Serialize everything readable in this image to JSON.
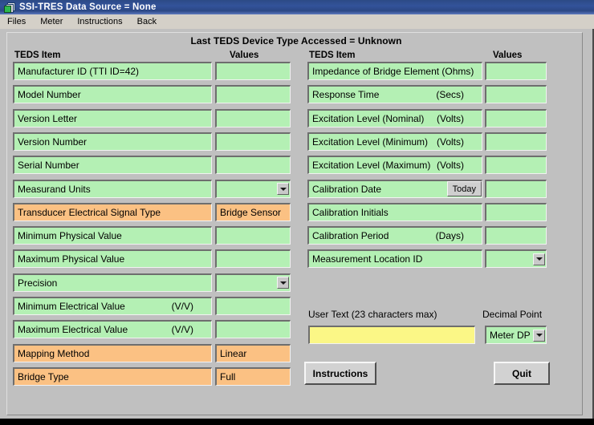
{
  "window": {
    "title": "SSI-TRES  Data Source =  None",
    "icon": "document-stack-icon"
  },
  "menubar": {
    "items": [
      {
        "label": "Files"
      },
      {
        "label": "Meter"
      },
      {
        "label": "Instructions"
      },
      {
        "label": "Back"
      }
    ]
  },
  "banner": {
    "text": "Last TEDS Device Type Accessed = Unknown"
  },
  "columns": {
    "left": {
      "item_header": "TEDS Item",
      "values_header": "Values"
    },
    "right": {
      "item_header": "TEDS Item",
      "values_header": "Values"
    }
  },
  "left_rows": [
    {
      "label": "Manufacturer ID   (TTI  ID=42)",
      "unit": "",
      "value": "",
      "color": "green",
      "control": "text"
    },
    {
      "label": "Model Number",
      "unit": "",
      "value": "",
      "color": "green",
      "control": "text"
    },
    {
      "label": "Version Letter",
      "unit": "",
      "value": "",
      "color": "green",
      "control": "text"
    },
    {
      "label": "Version Number",
      "unit": "",
      "value": "",
      "color": "green",
      "control": "text"
    },
    {
      "label": "Serial Number",
      "unit": "",
      "value": "",
      "color": "green",
      "control": "text"
    },
    {
      "label": "Measurand Units",
      "unit": "",
      "value": "",
      "color": "green",
      "control": "combo"
    },
    {
      "label": "Transducer Electrical Signal Type",
      "unit": "",
      "value": "Bridge Sensor",
      "color": "orange",
      "control": "text"
    },
    {
      "label": "Minimum Physical Value",
      "unit": "",
      "value": "",
      "color": "green",
      "control": "text"
    },
    {
      "label": "Maximum Physical Value",
      "unit": "",
      "value": "",
      "color": "green",
      "control": "text"
    },
    {
      "label": "Precision",
      "unit": "",
      "value": "",
      "color": "green",
      "control": "combo"
    },
    {
      "label": "Minimum Electrical Value",
      "unit": "(V/V)",
      "value": "",
      "color": "green",
      "control": "text"
    },
    {
      "label": "Maximum Electrical Value",
      "unit": "(V/V)",
      "value": "",
      "color": "green",
      "control": "text"
    },
    {
      "label": "Mapping Method",
      "unit": "",
      "value": "Linear",
      "color": "orange",
      "control": "text"
    },
    {
      "label": "Bridge Type",
      "unit": "",
      "value": "Full",
      "color": "orange",
      "control": "text"
    }
  ],
  "right_rows": [
    {
      "label": "Impedance of Bridge Element (Ohms)",
      "unit": "",
      "value": "",
      "color": "green",
      "control": "text"
    },
    {
      "label": "Response Time",
      "unit": "(Secs)",
      "value": "",
      "color": "green",
      "control": "text"
    },
    {
      "label": "Excitation Level (Nominal)",
      "unit": "(Volts)",
      "value": "",
      "color": "green",
      "control": "text"
    },
    {
      "label": "Excitation Level (Minimum)",
      "unit": "(Volts)",
      "value": "",
      "color": "green",
      "control": "text"
    },
    {
      "label": "Excitation Level (Maximum)",
      "unit": "(Volts)",
      "value": "",
      "color": "green",
      "control": "text"
    },
    {
      "label": "Calibration Date",
      "unit": "",
      "value": "",
      "color": "green",
      "control": "today"
    },
    {
      "label": "Calibration Initials",
      "unit": "",
      "value": "",
      "color": "green",
      "control": "text"
    },
    {
      "label": "Calibration Period",
      "unit": "(Days)",
      "value": "",
      "color": "green",
      "control": "text"
    },
    {
      "label": "Measurement Location ID",
      "unit": "",
      "value": "",
      "color": "green",
      "control": "combo"
    }
  ],
  "today_button": {
    "label": "Today"
  },
  "user_text": {
    "label": "User Text (23 characters max)",
    "value": "",
    "placeholder": ""
  },
  "decimal_point": {
    "label": "Decimal Point",
    "selected": "Meter DP"
  },
  "buttons": {
    "instructions": "Instructions",
    "quit": "Quit"
  },
  "colors": {
    "field_green": "#b4f0b4",
    "field_orange": "#fbc183",
    "field_yellow": "#fbf786",
    "window_face": "#c0c0c0",
    "titlebar_blue": "#2c4a86"
  }
}
